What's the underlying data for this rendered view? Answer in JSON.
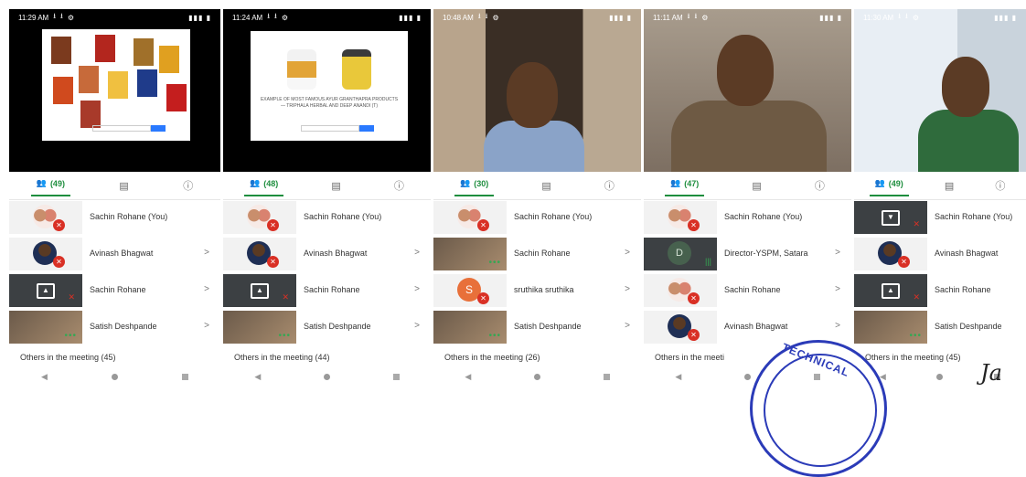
{
  "panels": [
    {
      "time": "11:29 AM",
      "video": "slide-books",
      "people_count": "(49)",
      "participants": [
        {
          "name": "Sachin Rohane (You)",
          "tile": "couple",
          "chevron": ""
        },
        {
          "name": "Avinash Bhagwat",
          "tile": "man",
          "chevron": ">"
        },
        {
          "name": "Sachin Rohane",
          "tile": "present",
          "chevron": ">"
        },
        {
          "name": "Satish Deshpande",
          "tile": "video",
          "chevron": ">"
        }
      ],
      "others": "Others in the meeting (45)"
    },
    {
      "time": "11:24 AM",
      "video": "slide-products",
      "slide_caption": "EXAMPLE OF MOST FAMOUS AYUR GRANTHAPRA PRODUCTS — TRIPHALA HERBAL AND DEEP ANANDI (T)",
      "people_count": "(48)",
      "participants": [
        {
          "name": "Sachin Rohane (You)",
          "tile": "couple",
          "chevron": ""
        },
        {
          "name": "Avinash Bhagwat",
          "tile": "man",
          "chevron": ">"
        },
        {
          "name": "Sachin Rohane",
          "tile": "present",
          "chevron": ">"
        },
        {
          "name": "Satish Deshpande",
          "tile": "video",
          "chevron": ">"
        }
      ],
      "others": "Others in the meeting (44)"
    },
    {
      "time": "10:48 AM",
      "video": "speaker-1",
      "people_count": "(30)",
      "participants": [
        {
          "name": "Sachin Rohane (You)",
          "tile": "couple",
          "chevron": ""
        },
        {
          "name": "Sachin Rohane",
          "tile": "video",
          "chevron": ">"
        },
        {
          "name": "sruthika sruthika",
          "tile": "s",
          "chevron": ">"
        },
        {
          "name": "Satish Deshpande",
          "tile": "video",
          "chevron": ">"
        }
      ],
      "others": "Others in the meeting (26)"
    },
    {
      "time": "11:11 AM",
      "video": "speaker-2",
      "people_count": "(47)",
      "participants": [
        {
          "name": "Sachin Rohane (You)",
          "tile": "couple",
          "chevron": ""
        },
        {
          "name": "Director-YSPM, Satara",
          "tile": "d",
          "chevron": ">"
        },
        {
          "name": "Sachin Rohane",
          "tile": "couple",
          "chevron": ">"
        },
        {
          "name": "Avinash Bhagwat",
          "tile": "man",
          "chevron": ">"
        }
      ],
      "others": "Others in the meeti"
    },
    {
      "time": "11:30 AM",
      "video": "speaker-3",
      "people_count": "(49)",
      "participants": [
        {
          "name": "Sachin Rohane (You)",
          "tile": "dark",
          "chevron": ""
        },
        {
          "name": "Avinash Bhagwat",
          "tile": "man",
          "chevron": ""
        },
        {
          "name": "Sachin Rohane",
          "tile": "present",
          "chevron": ""
        },
        {
          "name": "Satish Deshpande",
          "tile": "video",
          "chevron": ""
        }
      ],
      "others": "Others in the meeting (45)"
    }
  ],
  "icons": {
    "people": "people-icon",
    "chat": "chat-icon",
    "info": "info-icon"
  },
  "stamp_text": "TECHNICAL",
  "colors": {
    "accent": "#1e8e3e",
    "mic_off": "#d93025",
    "stamp": "#2b3bb8"
  }
}
